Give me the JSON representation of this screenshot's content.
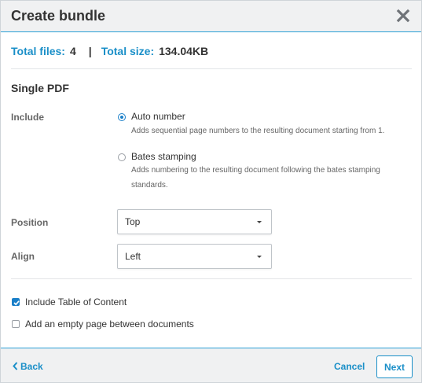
{
  "dialog": {
    "title": "Create bundle"
  },
  "summary": {
    "total_files_label": "Total files:",
    "total_files_value": "4",
    "separator": "|",
    "total_size_label": "Total size:",
    "total_size_value": "134.04KB"
  },
  "section_title": "Single PDF",
  "include": {
    "label": "Include",
    "options": [
      {
        "label": "Auto number",
        "description": "Adds sequential page numbers to the resulting document starting from 1.",
        "selected": true
      },
      {
        "label": "Bates stamping",
        "description": "Adds numbering to the resulting document following the bates stamping standards.",
        "selected": false
      }
    ]
  },
  "position": {
    "label": "Position",
    "value": "Top"
  },
  "align": {
    "label": "Align",
    "value": "Left"
  },
  "checkboxes": [
    {
      "label": "Include Table of Content",
      "checked": true
    },
    {
      "label": "Add an empty page between documents",
      "checked": false
    }
  ],
  "footer": {
    "back_label": "Back",
    "cancel_label": "Cancel",
    "next_label": "Next"
  },
  "colors": {
    "accent": "#1a8fc8",
    "header_bg": "#f0f1f2"
  },
  "icons": {
    "close": "close-icon",
    "back": "chevron-left-icon",
    "caret": "caret-down-icon",
    "check": "check-icon"
  }
}
